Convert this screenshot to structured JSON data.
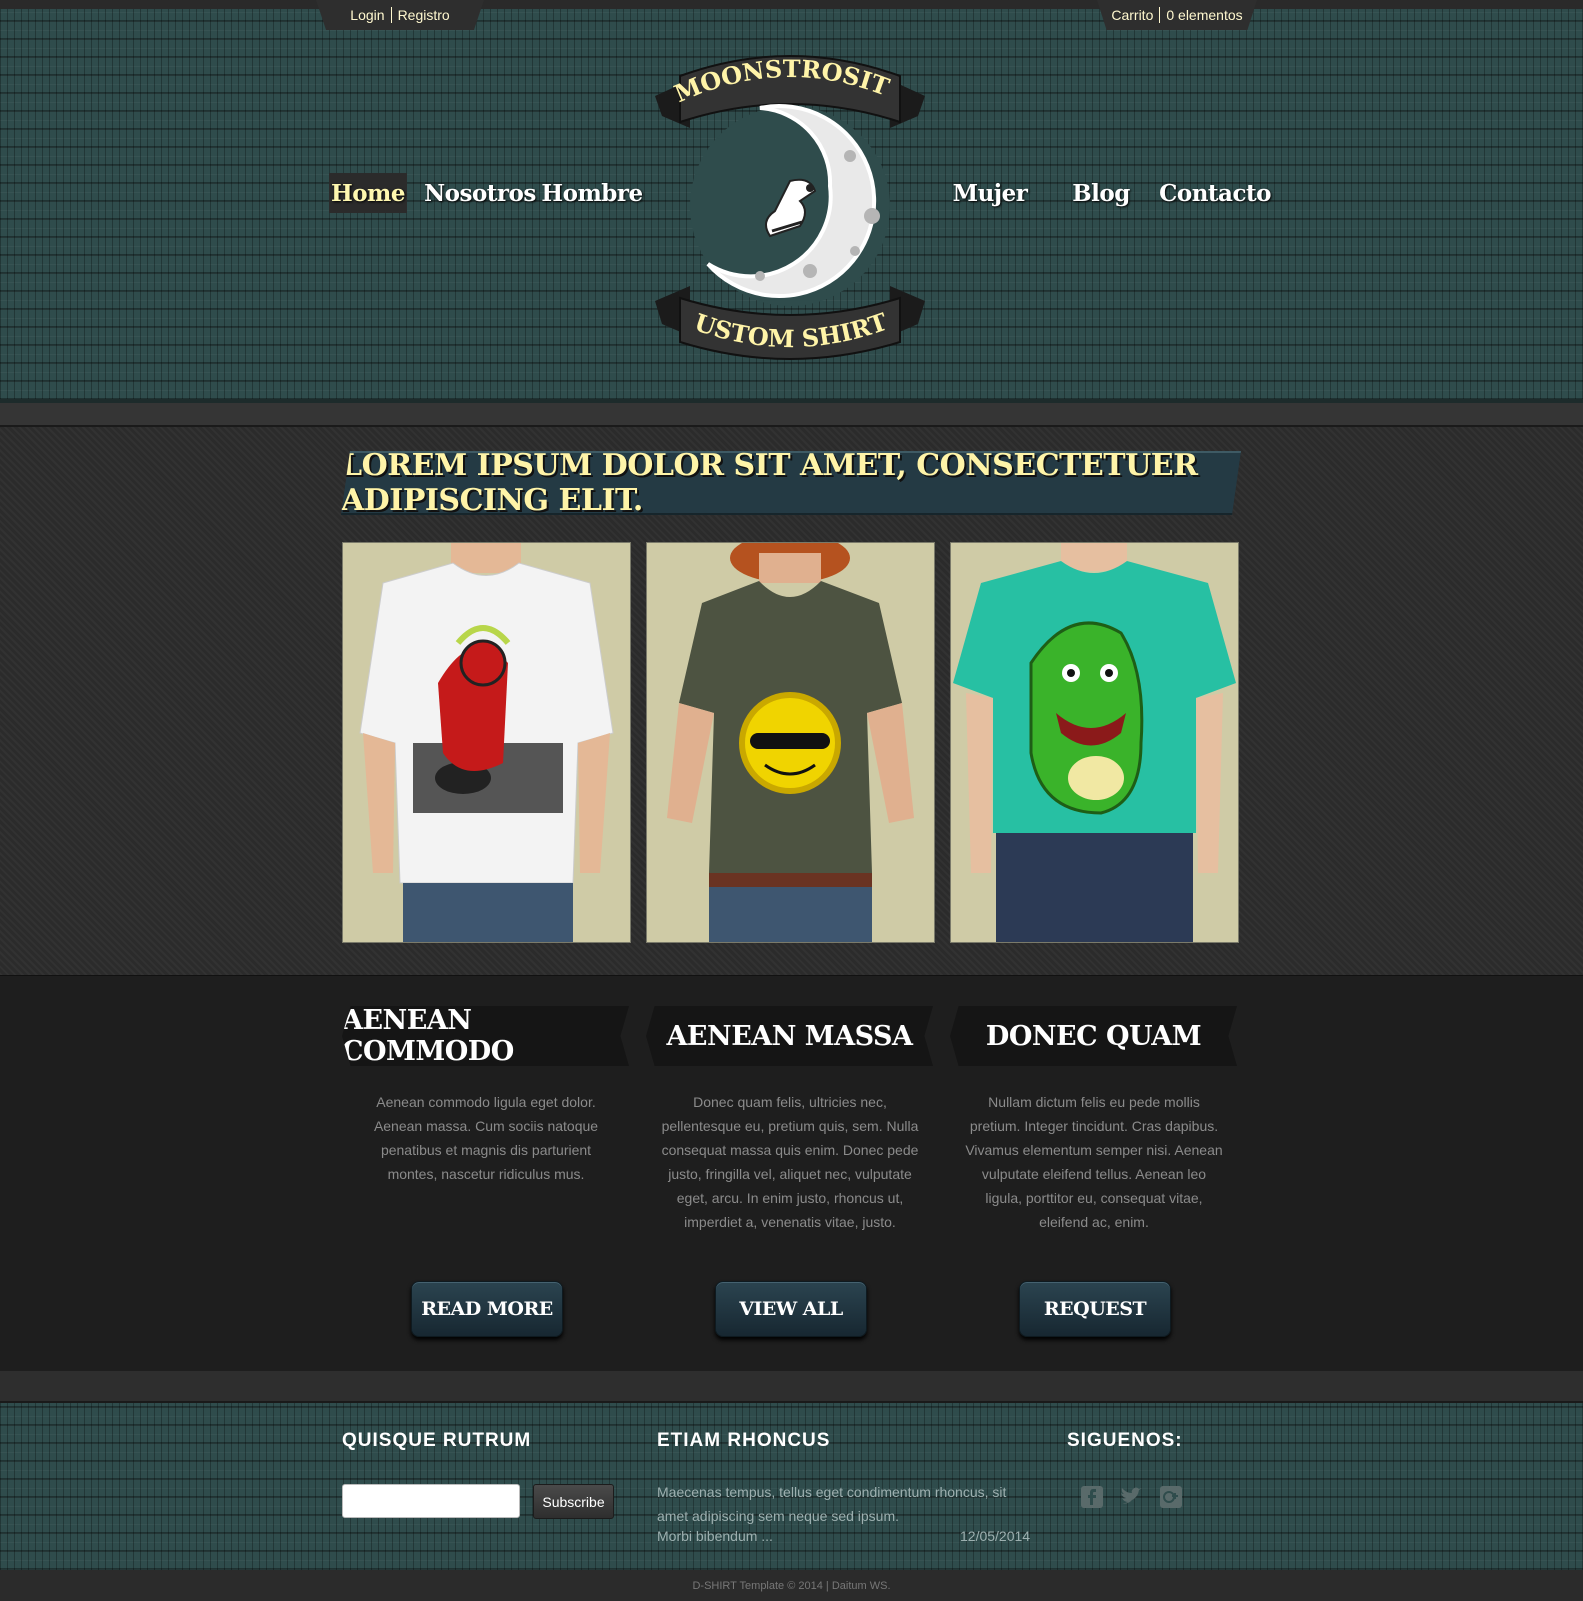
{
  "header": {
    "login_label": "Login",
    "register_label": "Registro",
    "cart_label": "Carrito",
    "cart_count": "0 elementos",
    "logo": {
      "top_text": "MOONSTROSITY",
      "bottom_text": "CUSTOM SHIRTS"
    },
    "nav": {
      "home": "Home",
      "about": "Nosotros",
      "men": "Hombre",
      "women": "Mujer",
      "blog": "Blog",
      "contact": "Contacto"
    }
  },
  "main": {
    "banner_text": "LOREM IPSUM DOLOR SIT AMET, CONSECTETUER ADIPISCING ELIT.",
    "photos": [
      {
        "shirt_color": "#f3f3f3",
        "design": "devil-dj"
      },
      {
        "shirt_color": "#4d5341",
        "design": "sun"
      },
      {
        "shirt_color": "#27c0a3",
        "design": "dragon"
      }
    ]
  },
  "features": [
    {
      "title": "AENEAN COMMODO",
      "text": "Aenean commodo ligula eget dolor. Aenean massa. Cum sociis natoque penatibus et magnis dis parturient montes, nascetur ridiculus mus.",
      "button": "READ MORE"
    },
    {
      "title": "AENEAN MASSA",
      "text": "Donec quam felis, ultricies nec, pellentesque eu, pretium quis, sem. Nulla consequat massa quis enim. Donec pede justo, fringilla vel, aliquet nec, vulputate eget, arcu. In enim justo, rhoncus ut, imperdiet a, venenatis vitae, justo.",
      "button": "VIEW ALL"
    },
    {
      "title": "DONEC QUAM",
      "text": "Nullam dictum felis eu pede mollis pretium. Integer tincidunt. Cras dapibus. Vivamus elementum semper nisi. Aenean vulputate eleifend tellus. Aenean leo ligula, porttitor eu, consequat vitae, eleifend ac, enim.",
      "button": "REQUEST"
    }
  ],
  "footer": {
    "newsletter_title": "QUISQUE RUTRUM",
    "subscribe_label": "Subscribe",
    "news_title": "ETIAM RHONCUS",
    "news_text": "Maecenas tempus, tellus eget condimentum rhoncus, sit amet adipiscing sem neque sed ipsum.",
    "news_more": "Morbi bibendum ...",
    "news_date": "12/05/2014",
    "social_title": "SIGUENOS:",
    "social_icons": [
      "facebook-icon",
      "twitter-icon",
      "google-plus-icon"
    ],
    "copyright": "D-SHIRT Template © 2014 | Daitum WS."
  },
  "colors": {
    "accent_yellow": "#fff4a8",
    "teal_pattern": "#2f4c4c",
    "button_blue": "#1f3540"
  }
}
